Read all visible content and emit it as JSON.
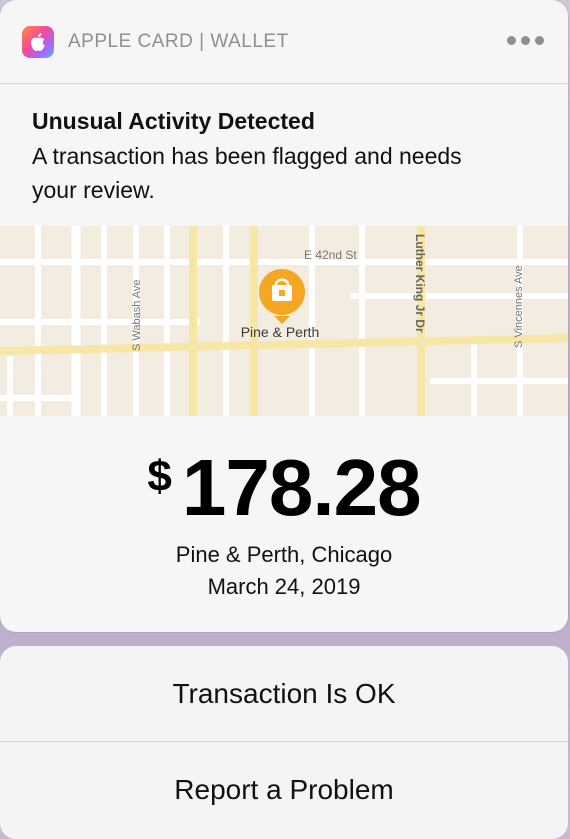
{
  "header": {
    "app_title": "APPLE CARD | WALLET",
    "app_icon": "apple-logo-icon",
    "more_icon": "ellipsis-icon"
  },
  "alert": {
    "title": "Unusual Activity Detected",
    "body": "A transaction has been flagged and needs your review."
  },
  "map": {
    "pin_label": "Pine & Perth",
    "pin_icon": "shopping-bag-icon",
    "streets": {
      "e42": "E 42nd St",
      "wabash": "S Wabash Ave",
      "mlk": "Luther King Jr Dr",
      "vincennes": "S Vincennes Ave"
    },
    "colors": {
      "land": "#f2ece1",
      "road": "#ffffff",
      "major_road": "#f7e7a6",
      "pin": "#f5a623"
    }
  },
  "transaction": {
    "currency": "$",
    "amount": "178.28",
    "location": "Pine & Perth, Chicago",
    "date": "March 24, 2019"
  },
  "actions": {
    "ok_label": "Transaction Is OK",
    "report_label": "Report a Problem"
  }
}
